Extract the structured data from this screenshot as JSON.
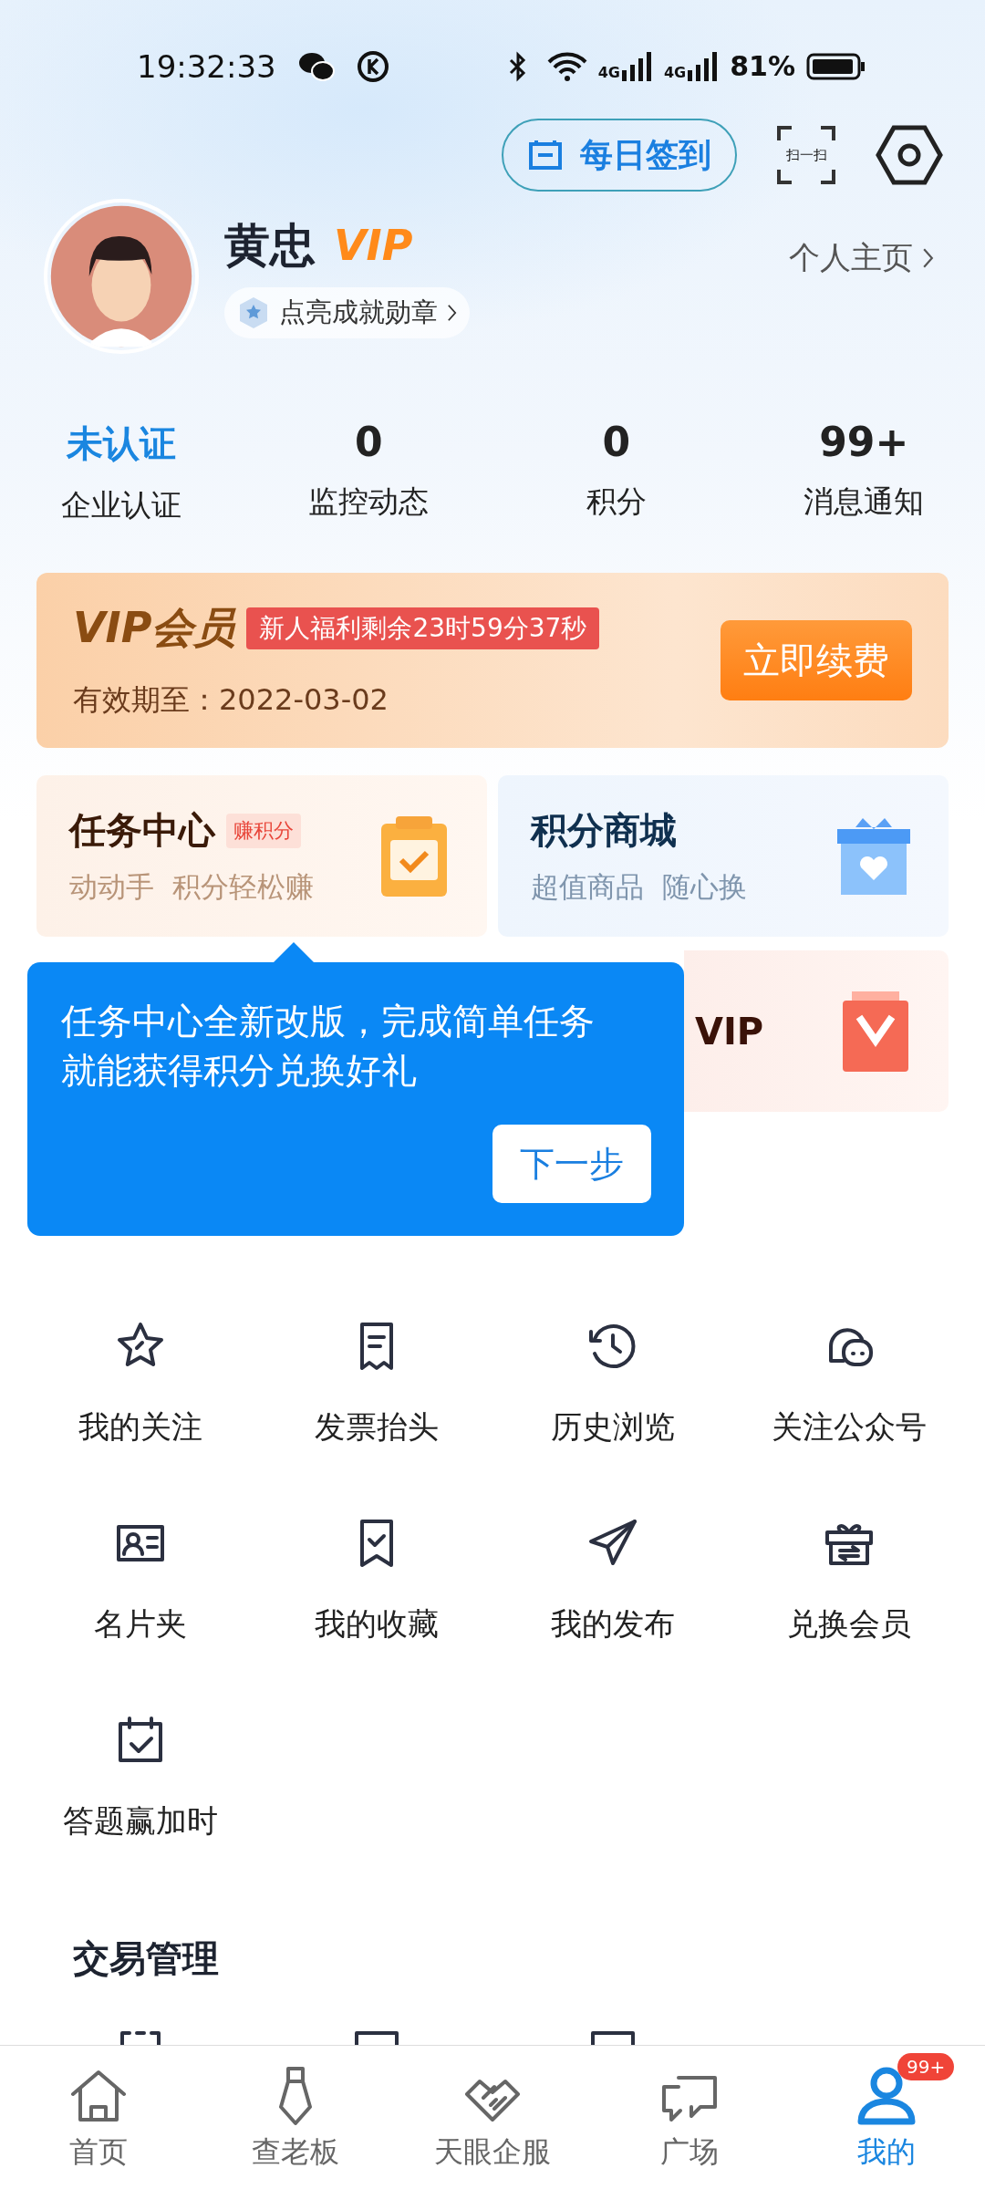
{
  "status_bar": {
    "time": "19:32:33",
    "network_1": "4G",
    "network_2": "4G",
    "battery": "81%"
  },
  "header": {
    "checkin": "每日签到",
    "scan": "扫一扫"
  },
  "profile": {
    "name": "黄忠",
    "vip_badge": "VIP",
    "medal_link": "点亮成就勋章",
    "homepage_link": "个人主页"
  },
  "stats": [
    {
      "value": "未认证",
      "label": "企业认证",
      "highlighted": true
    },
    {
      "value": "0",
      "label": "监控动态",
      "highlighted": false
    },
    {
      "value": "0",
      "label": "积分",
      "highlighted": false
    },
    {
      "value": "99+",
      "label": "消息通知",
      "highlighted": false
    }
  ],
  "vip_card": {
    "title": "VIP会员",
    "countdown": "新人福利剩余23时59分37秒",
    "expiry": "有效期至：2022-03-02",
    "button": "立即续费"
  },
  "cards": [
    {
      "kind": "task",
      "title": "任务中心",
      "tag": "赚积分",
      "subtitle": "动动手  积分轻松赚"
    },
    {
      "kind": "shop",
      "title": "积分商城",
      "subtitle": "超值商品  随心换"
    },
    {
      "kind": "gift",
      "title": "VIP"
    }
  ],
  "tooltip": {
    "text": "任务中心全新改版，完成简单任务就能获得积分兑换好礼",
    "button": "下一步"
  },
  "functions": [
    {
      "label": "我的关注"
    },
    {
      "label": "发票抬头"
    },
    {
      "label": "历史浏览"
    },
    {
      "label": "关注公众号"
    },
    {
      "label": "名片夹"
    },
    {
      "label": "我的收藏"
    },
    {
      "label": "我的发布"
    },
    {
      "label": "兑换会员"
    },
    {
      "label": "答题赢加时"
    }
  ],
  "trade": {
    "title": "交易管理"
  },
  "nav": [
    {
      "label": "首页",
      "selected": false
    },
    {
      "label": "查老板",
      "selected": false
    },
    {
      "label": "天眼企服",
      "selected": false
    },
    {
      "label": "广场",
      "selected": false
    },
    {
      "label": "我的",
      "selected": true,
      "badge": "99+"
    }
  ]
}
